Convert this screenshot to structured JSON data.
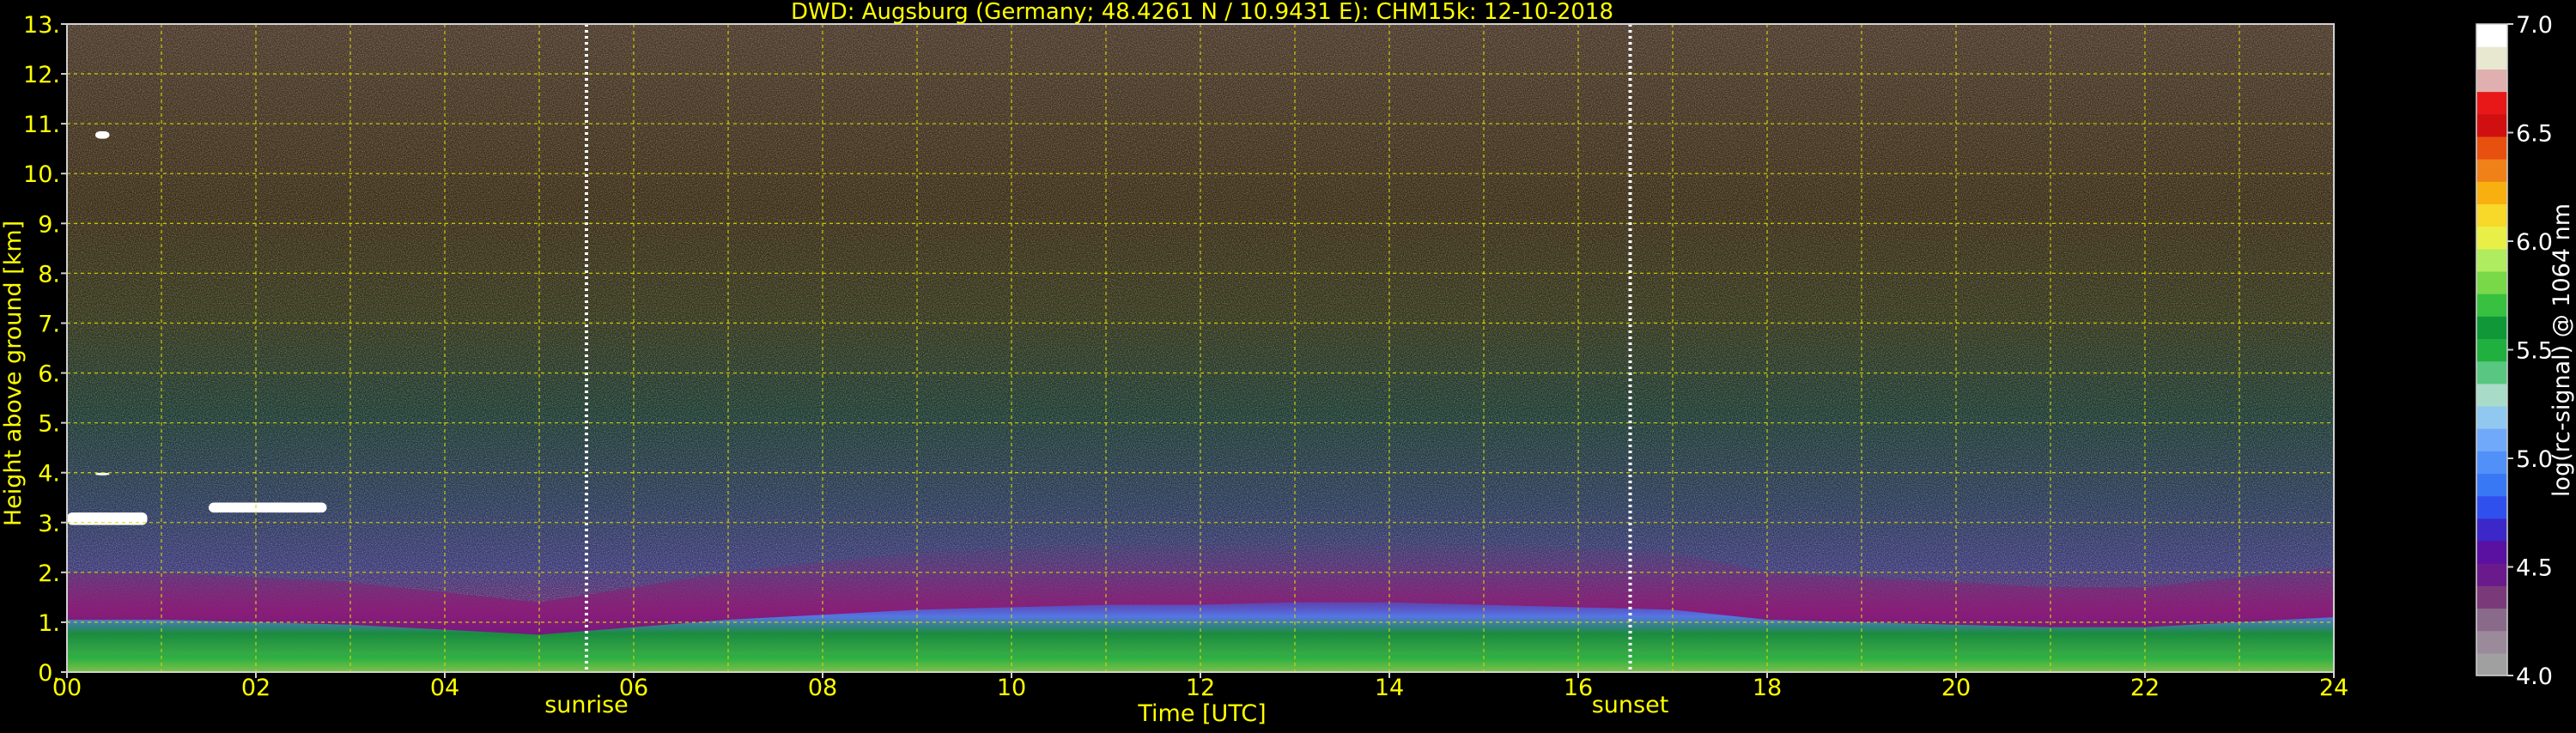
{
  "chart_data": {
    "type": "heatmap",
    "title": "DWD: Augsburg (Germany; 48.4261 N / 10.9431 E):    CHM15k: 12-10-2018",
    "xlabel": "Time [UTC]",
    "ylabel": "Height above ground [km]",
    "xlim": [
      0,
      24
    ],
    "ylim": [
      0,
      13
    ],
    "x_ticks": [
      "00",
      "02",
      "04",
      "06",
      "08",
      "10",
      "12",
      "14",
      "16",
      "18",
      "20",
      "22",
      "24"
    ],
    "y_ticks": [
      "0.",
      "1.",
      "2.",
      "3.",
      "4.",
      "5.",
      "6.",
      "7.",
      "8.",
      "9.",
      "10.",
      "11.",
      "12.",
      "13."
    ],
    "grid": true,
    "events": [
      {
        "label": "sunrise",
        "time": 5.5
      },
      {
        "label": "sunset",
        "time": 16.55
      }
    ],
    "colorbar": {
      "label": "log(rc-signal) @ 1064 nm",
      "min": 4.0,
      "max": 7.0,
      "ticks": [
        "4.0",
        "4.5",
        "5.0",
        "5.5",
        "6.0",
        "6.5",
        "7.0"
      ],
      "colors": [
        "#a0a0a0",
        "#9a8a9a",
        "#8a6a8a",
        "#7a3a7a",
        "#6a1a8a",
        "#5a10a0",
        "#3c28c8",
        "#3050ee",
        "#3878f4",
        "#5090f8",
        "#70a8fa",
        "#90c8f0",
        "#a8dcc8",
        "#58c880",
        "#20b040",
        "#109838",
        "#38c040",
        "#78d848",
        "#b0ec60",
        "#e8f048",
        "#f8d828",
        "#f8b010",
        "#f08018",
        "#e85010",
        "#d01010",
        "#e81818",
        "#e0b0b0",
        "#e8e8d0",
        "#ffffff"
      ]
    },
    "cloud_layers": [
      {
        "t_start": 0.3,
        "t_end": 0.45,
        "h_bottom": 10.7,
        "h_top": 10.85
      },
      {
        "t_start": 0.0,
        "t_end": 0.85,
        "h_bottom": 2.95,
        "h_top": 3.2
      },
      {
        "t_start": 1.5,
        "t_end": 2.75,
        "h_bottom": 3.2,
        "h_top": 3.4
      },
      {
        "t_start": 0.3,
        "t_end": 0.45,
        "h_bottom": 3.95,
        "h_top": 4.0
      }
    ],
    "boundary_layer": {
      "times": [
        0,
        1,
        2,
        3,
        4,
        5,
        6,
        7,
        8,
        9,
        10,
        11,
        12,
        13,
        14,
        15,
        16,
        17,
        18,
        19,
        20,
        21,
        22,
        23,
        24
      ],
      "aerosol_top_km": [
        1.0,
        1.0,
        0.95,
        0.9,
        0.8,
        0.7,
        0.85,
        1.0,
        1.1,
        1.2,
        1.25,
        1.3,
        1.3,
        1.35,
        1.35,
        1.3,
        1.25,
        1.2,
        1.0,
        0.95,
        0.9,
        0.85,
        0.85,
        0.95,
        1.05
      ]
    }
  }
}
